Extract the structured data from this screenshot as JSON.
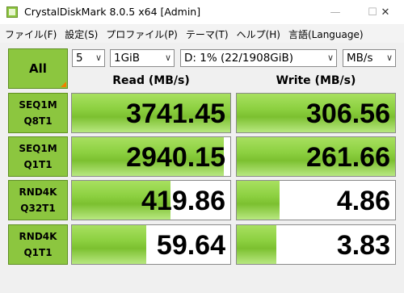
{
  "window": {
    "title": "CrystalDiskMark 8.0.5 x64 [Admin]",
    "controls": {
      "minimize": "—",
      "maximize": "☐",
      "close": "✕"
    }
  },
  "menu": [
    "ファイル(F)",
    "設定(S)",
    "プロファイル(P)",
    "テーマ(T)",
    "ヘルプ(H)",
    "言語(Language)"
  ],
  "controls": {
    "all_label": "All",
    "count": "5",
    "size": "1GiB",
    "drive": "D: 1% (22/1908GiB)",
    "unit": "MB/s",
    "dropdown_arrow": "∨"
  },
  "headers": {
    "read": "Read (MB/s)",
    "write": "Write (MB/s)"
  },
  "tests": [
    {
      "line1": "SEQ1M",
      "line2": "Q8T1",
      "read": "3741.45",
      "write": "306.56",
      "read_fill": 1.0,
      "write_fill": 1.0
    },
    {
      "line1": "SEQ1M",
      "line2": "Q1T1",
      "read": "2940.15",
      "write": "261.66",
      "read_fill": 0.96,
      "write_fill": 1.0
    },
    {
      "line1": "RND4K",
      "line2": "Q32T1",
      "read": "419.86",
      "write": "4.86",
      "read_fill": 0.62,
      "write_fill": 0.27
    },
    {
      "line1": "RND4K",
      "line2": "Q1T1",
      "read": "59.64",
      "write": "3.83",
      "read_fill": 0.47,
      "write_fill": 0.25
    }
  ],
  "colors": {
    "accent": "#8cc63f",
    "corner": "#f08000"
  }
}
